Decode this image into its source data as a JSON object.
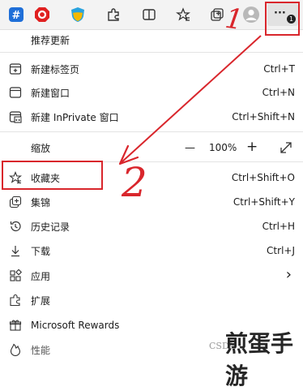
{
  "menu": {
    "check_updates": "推荐更新",
    "new_tab": {
      "label": "新建标签页",
      "shortcut": "Ctrl+T"
    },
    "new_window": {
      "label": "新建窗口",
      "shortcut": "Ctrl+N"
    },
    "new_inprivate": {
      "label": "新建 InPrivate 窗口",
      "shortcut": "Ctrl+Shift+N"
    },
    "zoom": {
      "label": "缩放",
      "minus": "—",
      "value": "100%",
      "plus": "+"
    },
    "favorites": {
      "label": "收藏夹",
      "shortcut": "Ctrl+Shift+O"
    },
    "collections": {
      "label": "集锦",
      "shortcut": "Ctrl+Shift+Y"
    },
    "history": {
      "label": "历史记录",
      "shortcut": "Ctrl+H"
    },
    "downloads": {
      "label": "下载",
      "shortcut": "Ctrl+J"
    },
    "apps": {
      "label": "应用",
      "chevron": "›"
    },
    "extensions": {
      "label": "扩展"
    },
    "rewards": {
      "label": "Microsoft Rewards"
    },
    "performance": {
      "label": "性能"
    }
  },
  "toolbar": {
    "more_label": "···",
    "badge": "1"
  },
  "annotations": {
    "step_one": "1",
    "step_two": "2"
  },
  "watermark": {
    "text": "煎蛋手游",
    "small": "CSDN"
  },
  "colors": {
    "annotation_red": "#d9262c",
    "menu_bg": "#ffffff",
    "toolbar_bg": "#f3f3f3"
  }
}
